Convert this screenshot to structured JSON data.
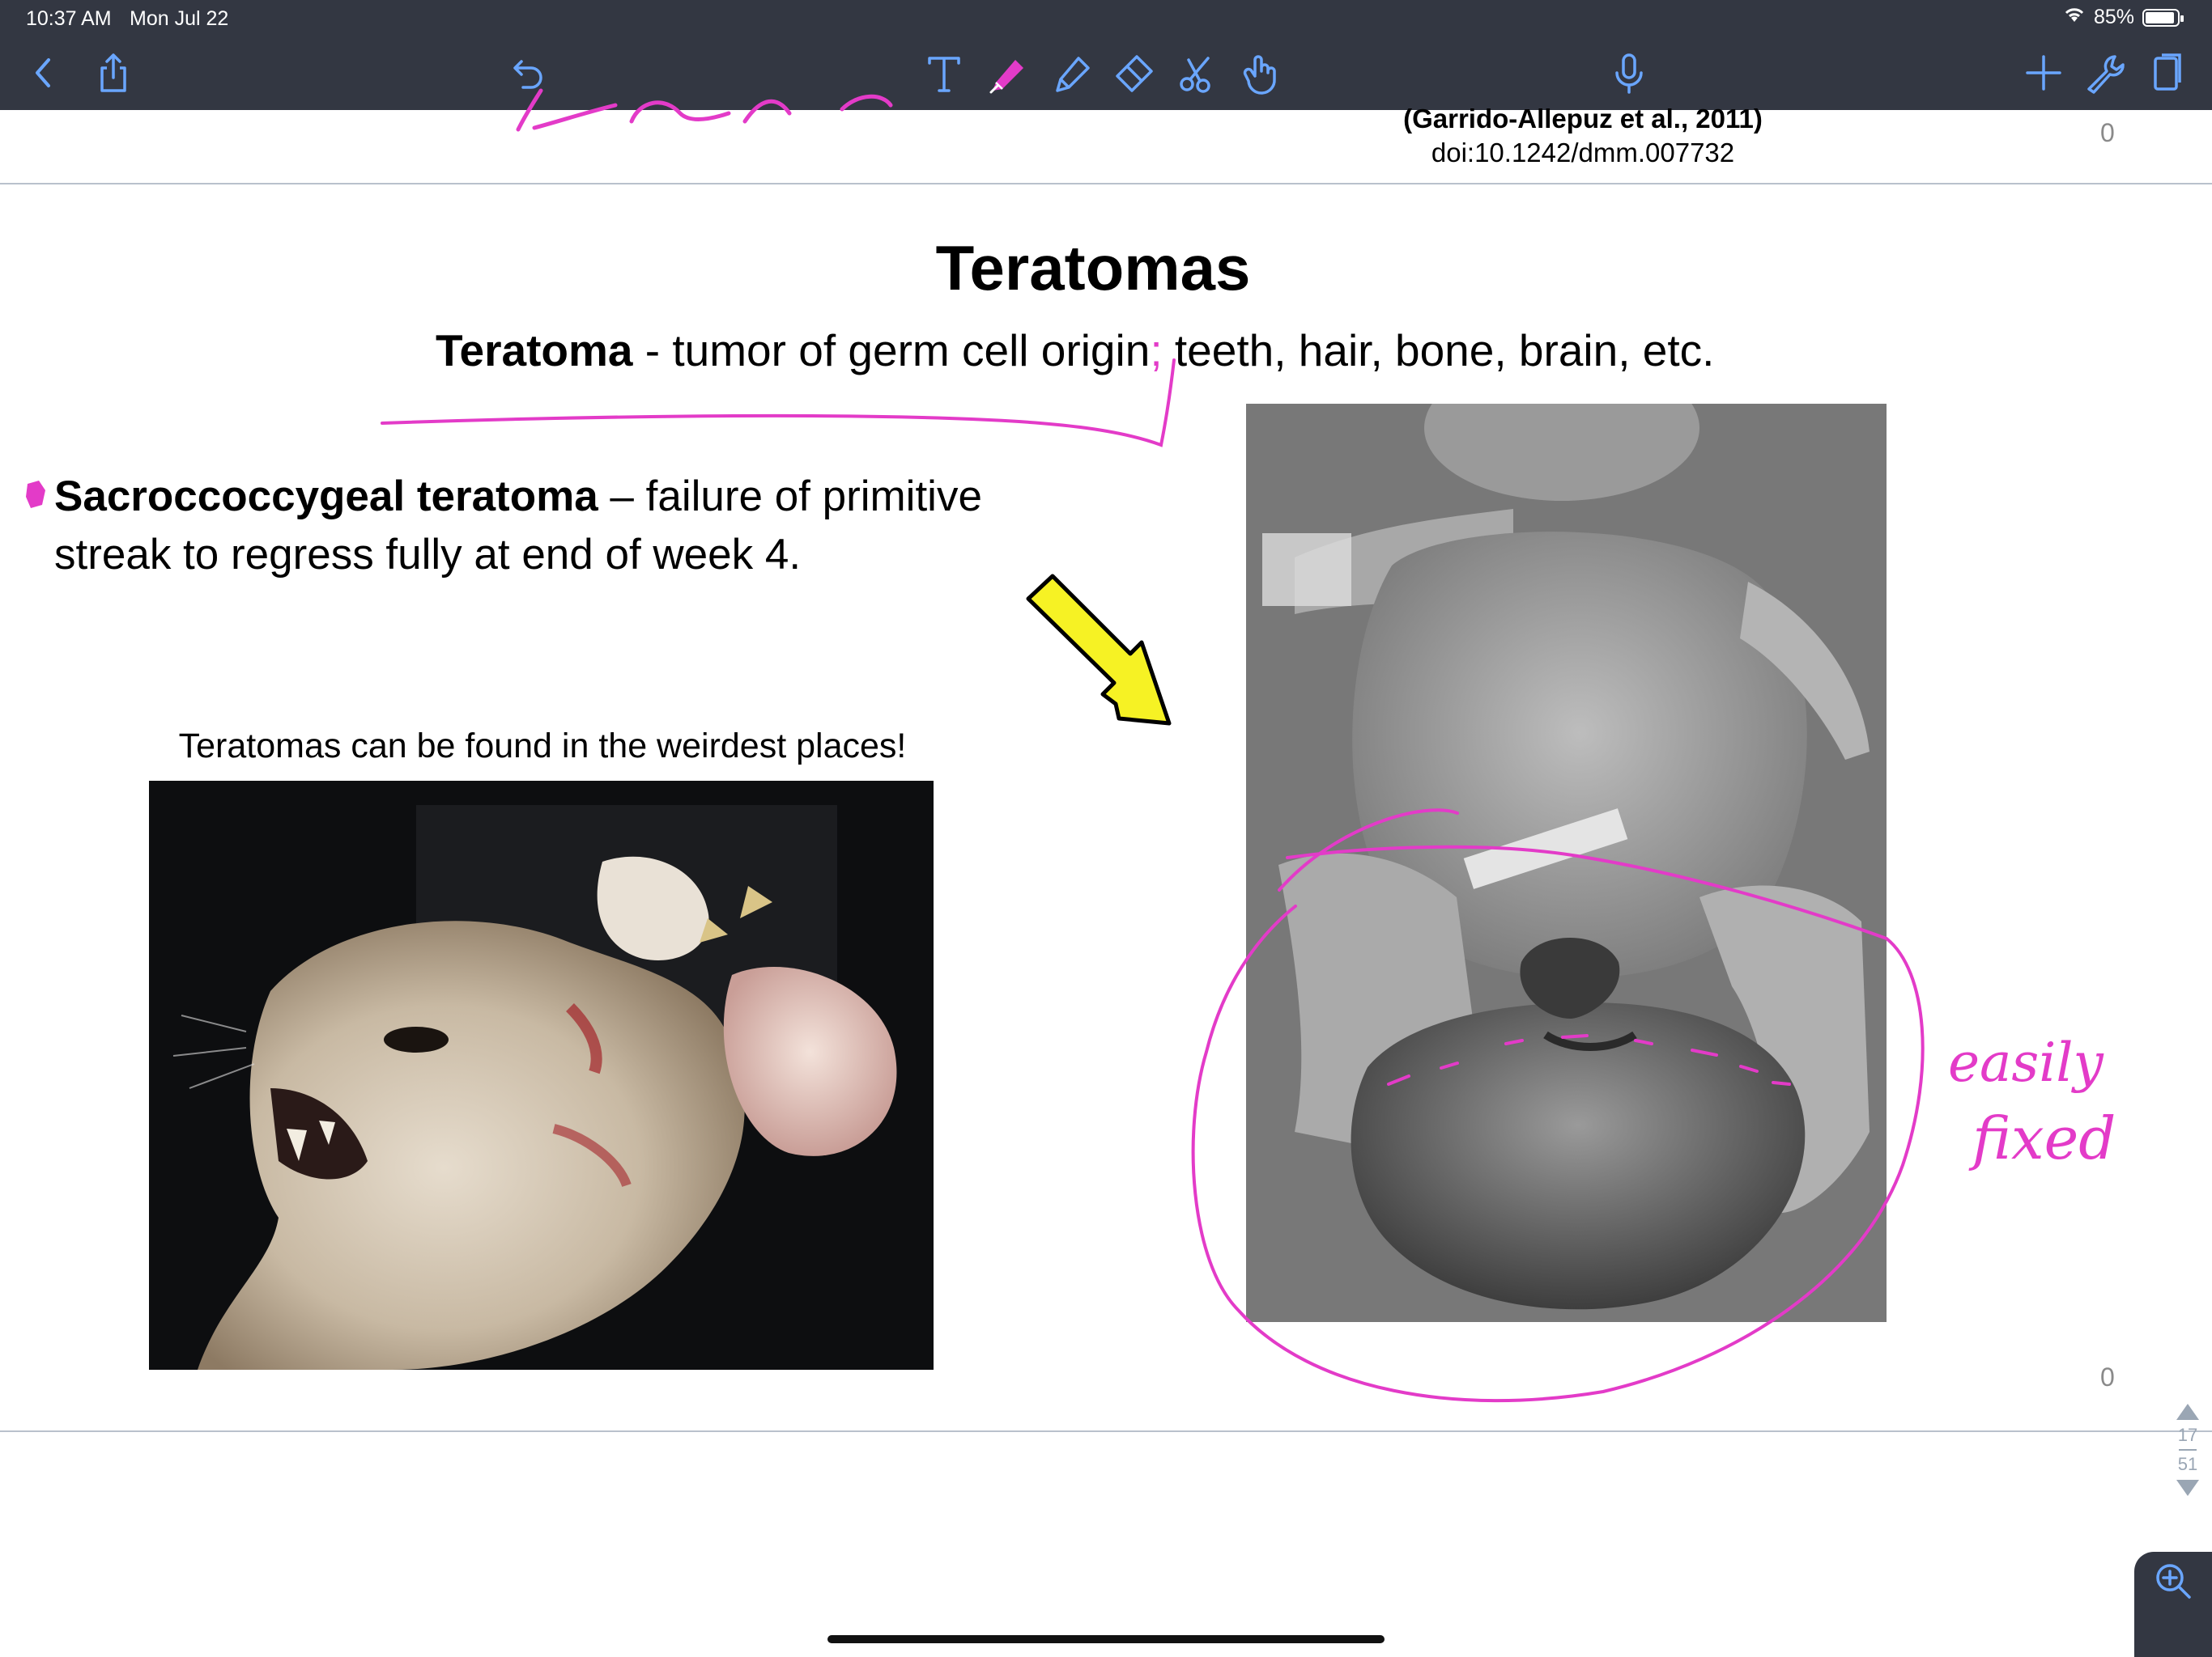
{
  "status_bar": {
    "time": "10:37 AM",
    "date": "Mon Jul 22",
    "battery": "85%"
  },
  "toolbar": {
    "left": [
      "back-icon",
      "share-icon",
      "undo-icon"
    ],
    "tools": [
      "text-tool-icon",
      "pen-tool-icon",
      "highlighter-tool-icon",
      "eraser-tool-icon",
      "lasso-scissors-icon",
      "hand-pointer-icon"
    ],
    "center": [
      "microphone-icon"
    ],
    "right": [
      "add-icon",
      "wrench-icon",
      "pages-icon"
    ],
    "active_tool": "pen",
    "ink_color": "#e33bc8"
  },
  "page_top": {
    "citation_line1": "(Garrido-Allepuz et al., 2011)",
    "citation_line2": "doi:10.1242/dmm.007732",
    "page_number": "0"
  },
  "slide": {
    "title": "Teratomas",
    "definition_term": "Teratoma",
    "definition_rest_a": " - tumor of germ cell origin",
    "definition_rest_b": " teeth, hair, bone, brain, etc.",
    "bullet_term": "Sacroccoccygeal teratoma",
    "bullet_rest": " – failure of primitive streak to regress fully at end of week 4.",
    "caption": "Teratomas can be found in the weirdest places!",
    "page_number": "0"
  },
  "handwriting": {
    "note_line1": "easily",
    "note_line2": "fixed"
  },
  "pager": {
    "current": "17",
    "total": "51"
  },
  "colors": {
    "toolbar": "#333742",
    "ink": "#e33bc8",
    "arrow_fill": "#f6f224",
    "rule": "#b9c1cc"
  }
}
